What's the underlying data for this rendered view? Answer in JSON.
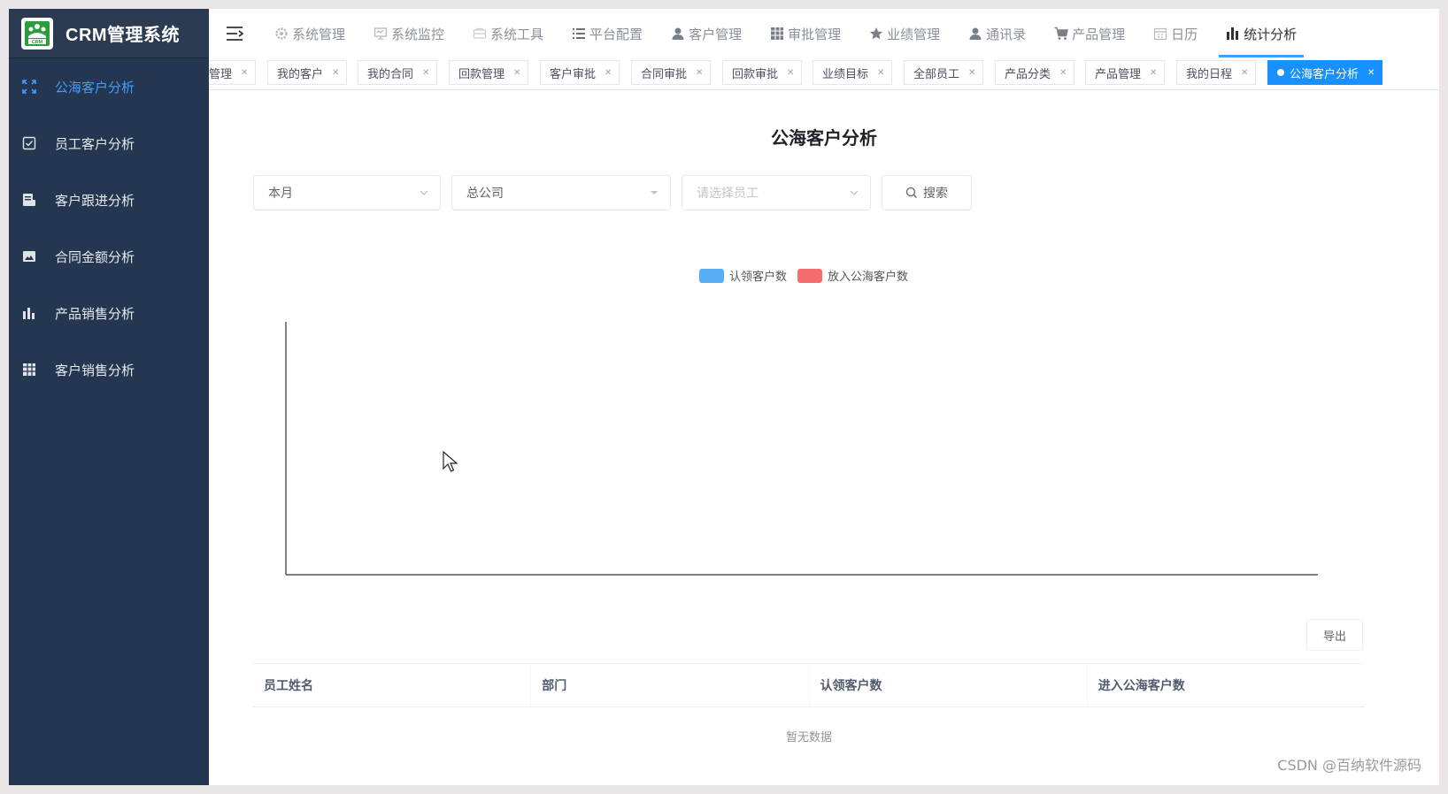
{
  "app": {
    "title": "CRM管理系统",
    "logo_text": "CRM"
  },
  "sidebar": {
    "items": [
      {
        "label": "公海客户分析",
        "icon": "expand-icon",
        "active": true
      },
      {
        "label": "员工客户分析",
        "icon": "checkbox-icon",
        "active": false
      },
      {
        "label": "客户跟进分析",
        "icon": "document-icon",
        "active": false
      },
      {
        "label": "合同金额分析",
        "icon": "image-icon",
        "active": false
      },
      {
        "label": "产品销售分析",
        "icon": "bar-chart-icon",
        "active": false
      },
      {
        "label": "客户销售分析",
        "icon": "table-icon",
        "active": false
      }
    ]
  },
  "topnav": {
    "items": [
      {
        "label": "系统管理",
        "icon": "gear-icon"
      },
      {
        "label": "系统监控",
        "icon": "monitor-icon"
      },
      {
        "label": "系统工具",
        "icon": "tool-icon"
      },
      {
        "label": "平台配置",
        "icon": "list-icon"
      },
      {
        "label": "客户管理",
        "icon": "user-icon"
      },
      {
        "label": "审批管理",
        "icon": "grid-icon"
      },
      {
        "label": "业绩管理",
        "icon": "star-icon"
      },
      {
        "label": "通讯录",
        "icon": "user-icon"
      },
      {
        "label": "产品管理",
        "icon": "cart-icon"
      },
      {
        "label": "日历",
        "icon": "calendar-icon"
      },
      {
        "label": "统计分析",
        "icon": "bar-chart-icon",
        "active": true
      }
    ]
  },
  "tags": [
    {
      "label": "管理"
    },
    {
      "label": "我的客户"
    },
    {
      "label": "我的合同"
    },
    {
      "label": "回款管理"
    },
    {
      "label": "客户审批"
    },
    {
      "label": "合同审批"
    },
    {
      "label": "回款审批"
    },
    {
      "label": "业绩目标"
    },
    {
      "label": "全部员工"
    },
    {
      "label": "产品分类"
    },
    {
      "label": "产品管理"
    },
    {
      "label": "我的日程"
    },
    {
      "label": "公海客户分析",
      "active": true
    }
  ],
  "page": {
    "title": "公海客户分析",
    "filters": {
      "period": "本月",
      "company": "总公司",
      "employee_placeholder": "请选择员工"
    },
    "search_label": "搜索",
    "export_label": "导出"
  },
  "chart_data": {
    "type": "bar",
    "categories": [],
    "series": [
      {
        "name": "认领客户数",
        "values": [],
        "color": "#5aaef5"
      },
      {
        "name": "放入公海客户数",
        "values": [],
        "color": "#f56c6c"
      }
    ],
    "legend": "top-center",
    "grid": false
  },
  "table": {
    "columns": [
      "员工姓名",
      "部门",
      "认领客户数",
      "进入公海客户数"
    ],
    "rows": [],
    "empty_text": "暂无数据"
  },
  "watermark": "CSDN @百纳软件源码"
}
